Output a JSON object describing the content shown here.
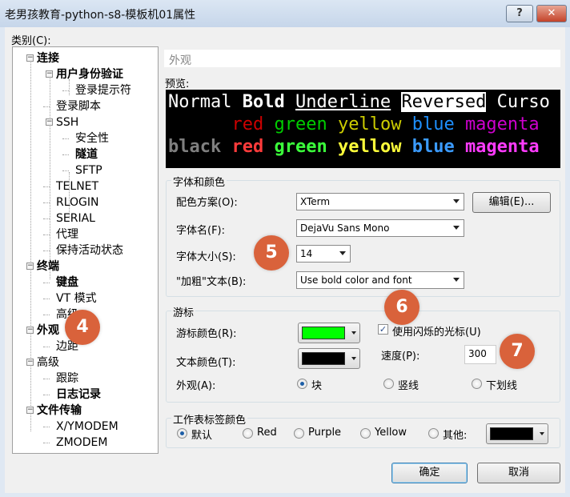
{
  "window": {
    "title": "老男孩教育-python-s8-模板机01属性",
    "help_label": "?",
    "close_label": "✕"
  },
  "category_label": "类别(C):",
  "tree": [
    {
      "label": "连接",
      "bold": true
    },
    {
      "label": "用户身份验证",
      "bold": true
    },
    {
      "label": "登录提示符",
      "bold": false
    },
    {
      "label": "登录脚本",
      "bold": false
    },
    {
      "label": "SSH",
      "bold": false
    },
    {
      "label": "安全性",
      "bold": false
    },
    {
      "label": "隧道",
      "bold": true
    },
    {
      "label": "SFTP",
      "bold": false
    },
    {
      "label": "TELNET",
      "bold": false
    },
    {
      "label": "RLOGIN",
      "bold": false
    },
    {
      "label": "SERIAL",
      "bold": false
    },
    {
      "label": "代理",
      "bold": false
    },
    {
      "label": "保持活动状态",
      "bold": false
    },
    {
      "label": "终端",
      "bold": true
    },
    {
      "label": "键盘",
      "bold": true
    },
    {
      "label": "VT 模式",
      "bold": false
    },
    {
      "label": "高级",
      "bold": false
    },
    {
      "label": "外观",
      "bold": true
    },
    {
      "label": "边距",
      "bold": false
    },
    {
      "label": "高级",
      "bold": false
    },
    {
      "label": "跟踪",
      "bold": false
    },
    {
      "label": "日志记录",
      "bold": true
    },
    {
      "label": "文件传输",
      "bold": true
    },
    {
      "label": "X/YMODEM",
      "bold": false
    },
    {
      "label": "ZMODEM",
      "bold": false
    }
  ],
  "section_header": "外观",
  "preview": {
    "label": "预览:",
    "line1": {
      "normal": "Normal",
      "bold": "Bold",
      "underline": "Underline",
      "reversed": "Reversed",
      "cursor": "Curso"
    },
    "colors": [
      "black",
      "red",
      "green",
      "yellow",
      "blue",
      "magenta"
    ],
    "normal_colors": {
      "black": "#000000",
      "red": "#cd0000",
      "green": "#00cd00",
      "yellow": "#cdcd00",
      "blue": "#1e90ff",
      "magenta": "#cd00cd"
    },
    "bold_colors": {
      "black": "#7f7f7f",
      "red": "#ff3b3b",
      "green": "#3bff3b",
      "yellow": "#ffff3b",
      "blue": "#3b9bff",
      "magenta": "#ff3bff"
    }
  },
  "font_group": {
    "title": "字体和颜色",
    "scheme_label": "配色方案(O):",
    "scheme_value": "XTerm",
    "edit_button": "编辑(E)...",
    "font_label": "字体名(F):",
    "font_value": "DejaVu Sans Mono",
    "size_label": "字体大小(S):",
    "size_value": "14",
    "bold_label": "\"加粗\"文本(B):",
    "bold_value": "Use bold color and font"
  },
  "cursor_group": {
    "title": "游标",
    "cursor_color_label": "游标颜色(R):",
    "cursor_color": "#00ff00",
    "text_color_label": "文本颜色(T):",
    "text_color": "#000000",
    "blink_label": "使用闪烁的光标(U)",
    "blink_checked": true,
    "speed_label": "速度(P):",
    "speed_value": "300",
    "appearance_label": "外观(A):",
    "shapes": [
      {
        "label": "块",
        "selected": true
      },
      {
        "label": "竖线",
        "selected": false
      },
      {
        "label": "下划线",
        "selected": false
      }
    ]
  },
  "tab_color_group": {
    "title": "工作表标签颜色",
    "options": [
      {
        "label": "默认",
        "selected": true
      },
      {
        "label": "Red",
        "selected": false
      },
      {
        "label": "Purple",
        "selected": false
      },
      {
        "label": "Yellow",
        "selected": false
      },
      {
        "label": "其他:",
        "selected": false
      }
    ],
    "other_color": "#000000"
  },
  "buttons": {
    "ok": "确定",
    "cancel": "取消"
  },
  "badges": [
    "4",
    "5",
    "6",
    "7"
  ],
  "accent_badge_color": "#d9623b"
}
